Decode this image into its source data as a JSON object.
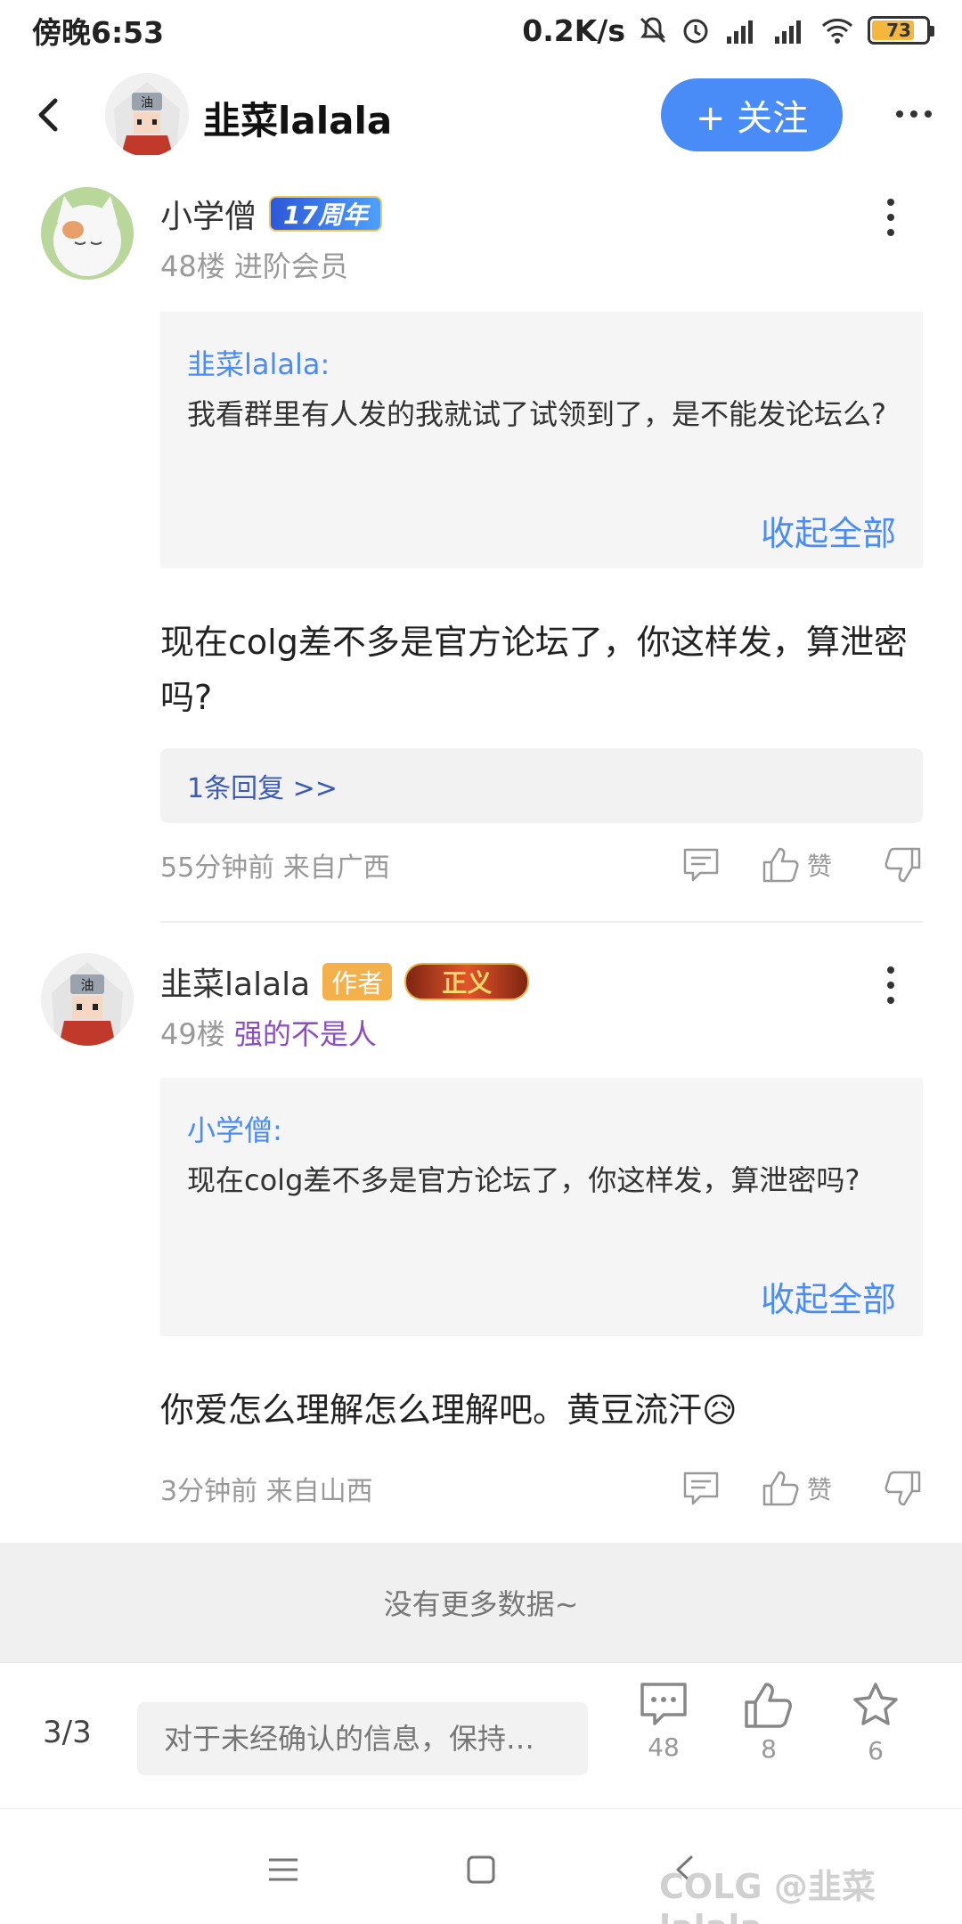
{
  "status_bar": {
    "time": "傍晚6:53",
    "net_speed": "0.2K/s",
    "battery": "73",
    "battery_level": 0.73,
    "icons": [
      "mute-icon",
      "alarm-icon",
      "hd-signal-icon",
      "hd-signal-icon",
      "wifi-icon",
      "battery-icon"
    ]
  },
  "header": {
    "username": "韭菜lalala",
    "follow_label": "+ 关注"
  },
  "posts": [
    {
      "author": "小学僧",
      "badge": "17周年",
      "floor_meta": "48楼 进阶会员",
      "quote": {
        "user": "韭菜lalala:",
        "text": "我看群里有人发的我就试了试领到了，是不能发论坛么?",
        "collapse": "收起全部"
      },
      "content": "现在colg差不多是官方论坛了，你这样发，算泄密吗?",
      "replies": "1条回复 >>",
      "time": "55分钟前 来自广西",
      "like_label": "赞"
    },
    {
      "author": "韭菜lalala",
      "author_badge": "作者",
      "level_badge": "正义",
      "floor": "49楼",
      "title": "强的不是人",
      "quote": {
        "user": "小学僧:",
        "text": "现在colg差不多是官方论坛了，你这样发，算泄密吗?",
        "collapse": "收起全部"
      },
      "content": "你爱怎么理解怎么理解吧。黄豆流汗😥",
      "time": "3分钟前 来自山西",
      "like_label": "赞"
    }
  ],
  "no_more": "没有更多数据~",
  "bottom_bar": {
    "page": "3/3",
    "input_placeholder": "对于未经确认的信息，保持…",
    "comments": "48",
    "likes": "8",
    "favorites": "6"
  },
  "watermark": "COLG @韭菜lalala",
  "colors": {
    "accent": "#4a8cf7",
    "purple_title": "#8d4dc2",
    "author_badge": "#f4b04a"
  }
}
